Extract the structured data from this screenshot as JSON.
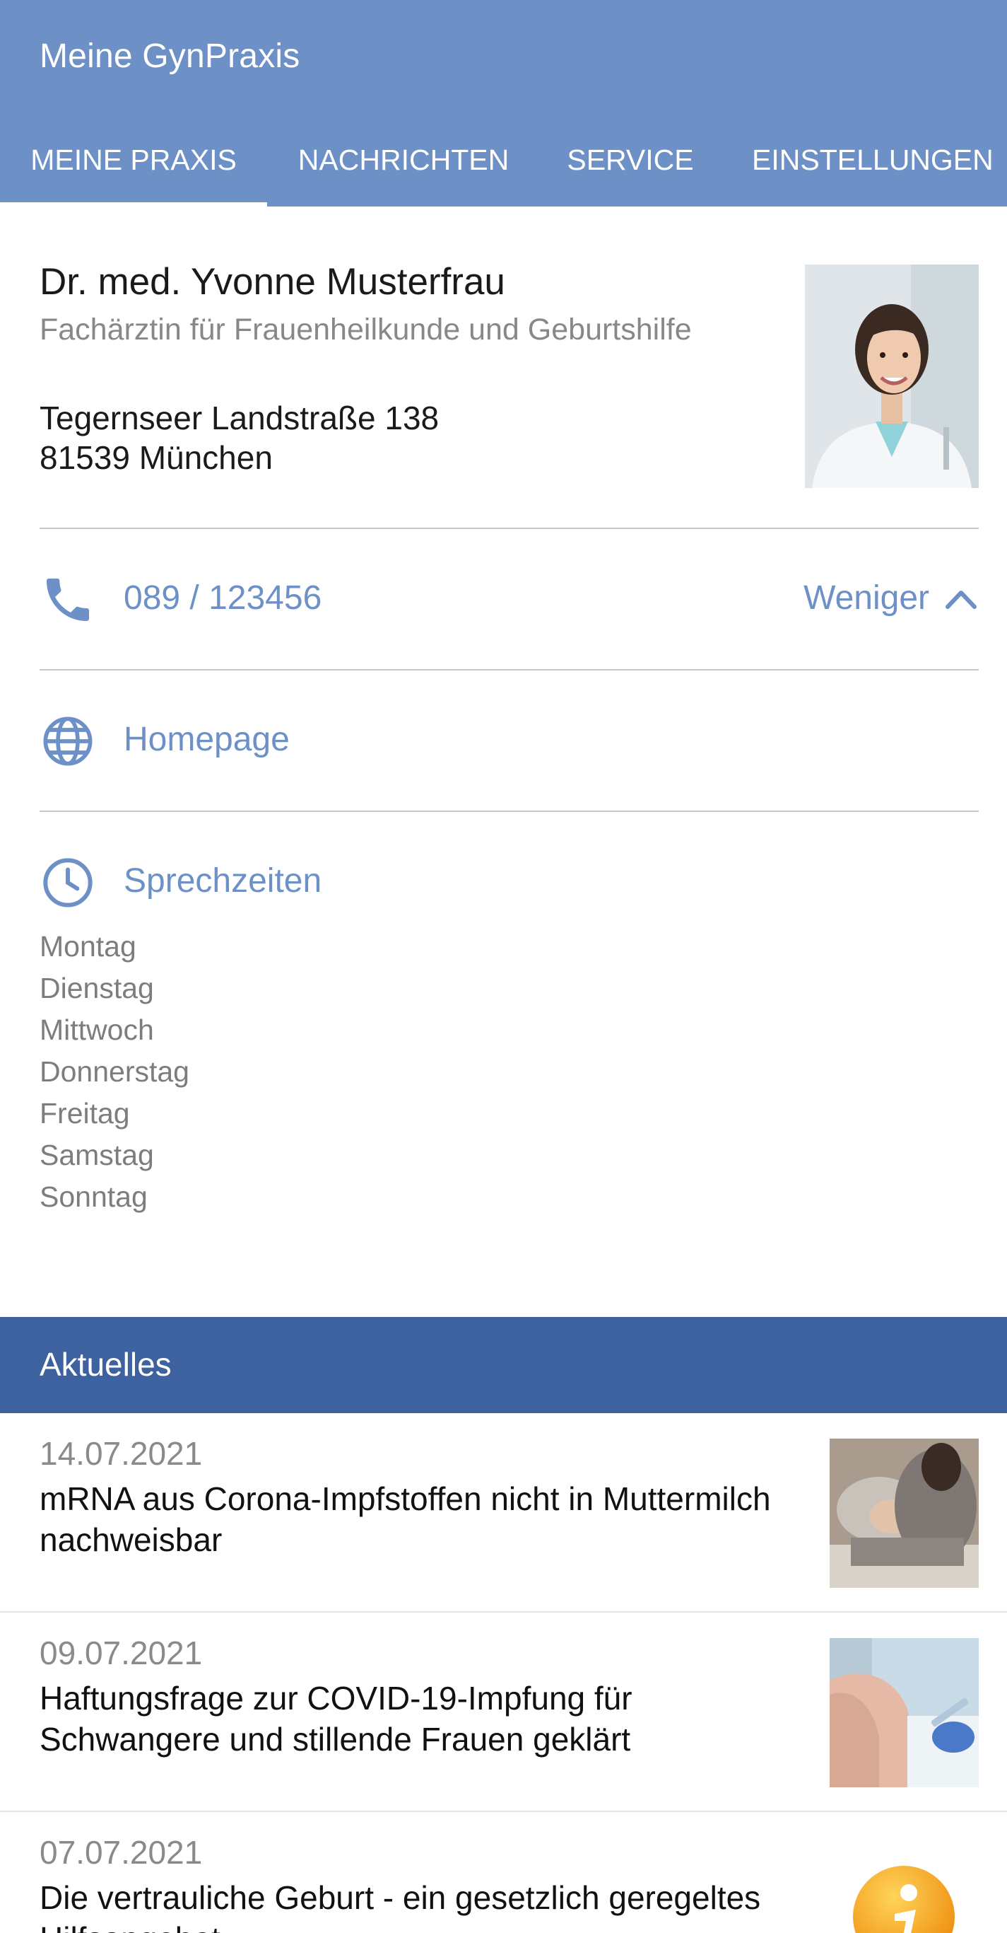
{
  "app": {
    "title": "Meine GynPraxis"
  },
  "tabs": [
    {
      "label": "MEINE PRAXIS",
      "active": true
    },
    {
      "label": "NACHRICHTEN",
      "active": false
    },
    {
      "label": "SERVICE",
      "active": false
    },
    {
      "label": "EINSTELLUNGEN",
      "active": false
    }
  ],
  "doctor": {
    "name": "Dr. med. Yvonne Musterfrau",
    "specialty": "Fachärztin für Frauenheilkunde und Geburtshilfe",
    "address_line1": "Tegernseer Landstraße 138",
    "address_line2": "81539 München"
  },
  "contact": {
    "phone": "089 / 123456",
    "toggle_label": "Weniger",
    "homepage_label": "Homepage",
    "hours_label": "Sprechzeiten"
  },
  "hours": {
    "days": [
      "Montag",
      "Dienstag",
      "Mittwoch",
      "Donnerstag",
      "Freitag",
      "Samstag",
      "Sonntag"
    ]
  },
  "news": {
    "section_title": "Aktuelles",
    "items": [
      {
        "date": "14.07.2021",
        "title": "mRNA aus Corona-Impfstoffen nicht in Muttermilch nachweisbar"
      },
      {
        "date": "09.07.2021",
        "title": "Haftungsfrage zur COVID-19-Impfung für Schwangere und stillende Frauen geklärt"
      },
      {
        "date": "07.07.2021",
        "title": "Die vertrauliche Geburt - ein gesetzlich geregeltes Hilfsangebot"
      }
    ]
  },
  "colors": {
    "appbar": "#6d91c7",
    "section_bar": "#3e61a0",
    "link": "#6d91c7",
    "muted_text": "#888888"
  },
  "icons": {
    "phone": "phone-icon",
    "homepage": "globe-icon",
    "hours": "clock-icon",
    "toggle": "chevron-up-icon",
    "news_info": "info-icon"
  }
}
